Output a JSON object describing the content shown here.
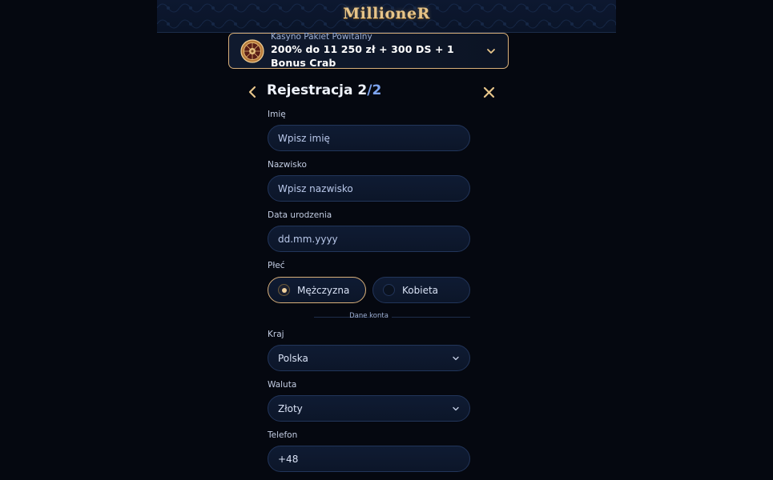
{
  "brand": {
    "logo_text": "MillioneR"
  },
  "promo": {
    "subtitle": "Kasyno Pakiet Powitalny",
    "headline": "200% do 11 250 zł + 300 DS + 1 Bonus Crab",
    "icon": "roulette-wheel-icon"
  },
  "header": {
    "title": "Rejestracja",
    "step": "2",
    "total": "/2"
  },
  "form": {
    "first_name": {
      "label": "Imię",
      "placeholder": "Wpisz imię"
    },
    "last_name": {
      "label": "Nazwisko",
      "placeholder": "Wpisz nazwisko"
    },
    "birth_date": {
      "label": "Data urodzenia",
      "placeholder": "dd.mm.yyyy"
    },
    "gender": {
      "label": "Płeć",
      "options": [
        {
          "label": "Mężczyzna",
          "selected": true
        },
        {
          "label": "Kobieta",
          "selected": false
        }
      ]
    },
    "section_account": "Dane konta",
    "country": {
      "label": "Kraj",
      "value": "Polska"
    },
    "currency": {
      "label": "Waluta",
      "value": "Złoty"
    },
    "phone": {
      "label": "Telefon",
      "value": "+48"
    }
  },
  "colors": {
    "background": "#050810",
    "accent_gold": "#d9b07a",
    "accent_blue": "#7ea5f0",
    "field_bg": "#0f1b33",
    "field_border": "#22355a"
  }
}
